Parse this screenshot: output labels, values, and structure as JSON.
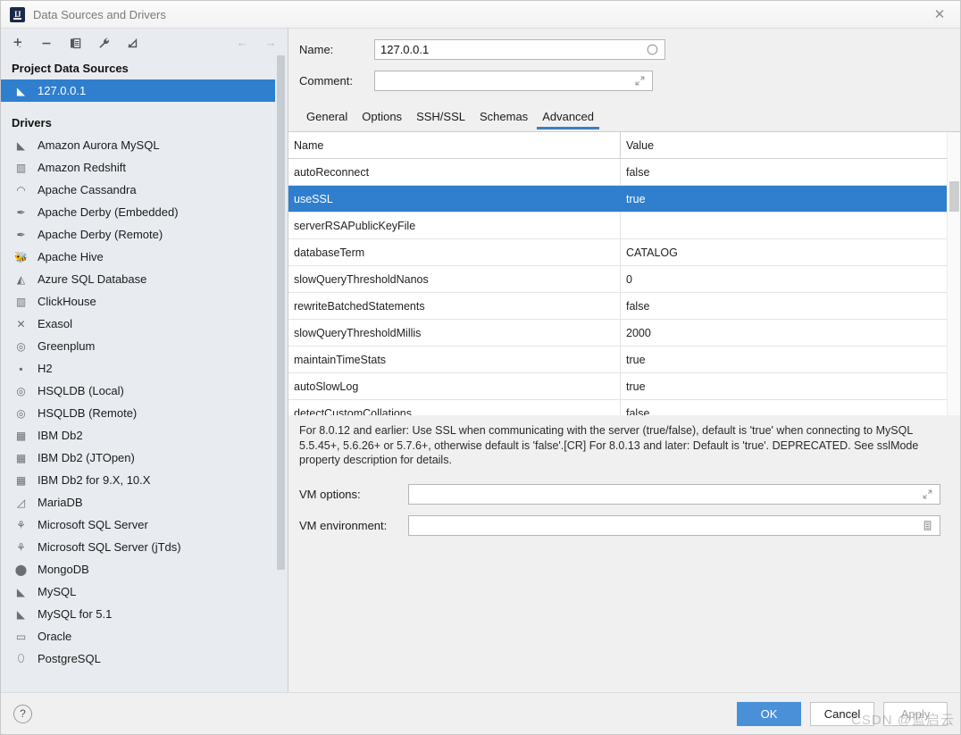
{
  "window": {
    "title": "Data Sources and Drivers",
    "app_icon": "intellij-icon",
    "close_icon": "✕"
  },
  "toolbar": {
    "items": [
      {
        "name": "add-button",
        "glyph": "+"
      },
      {
        "name": "remove-button",
        "glyph": "−"
      },
      {
        "name": "copy-button",
        "glyph": "❐"
      },
      {
        "name": "settings-wrench-button",
        "glyph": "🔧"
      },
      {
        "name": "import-button",
        "glyph": "⤦"
      }
    ],
    "back_glyph": "←",
    "forward_glyph": "→"
  },
  "sidebar": {
    "project_group_title": "Project Data Sources",
    "data_sources": [
      {
        "label": "127.0.0.1",
        "icon": "mysql-icon",
        "glyph": "◣",
        "selected": true
      }
    ],
    "drivers_group_title": "Drivers",
    "drivers": [
      {
        "label": "Amazon Aurora MySQL",
        "icon": "mysql-icon",
        "glyph": "◣"
      },
      {
        "label": "Amazon Redshift",
        "icon": "redshift-icon",
        "glyph": "▥"
      },
      {
        "label": "Apache Cassandra",
        "icon": "cassandra-icon",
        "glyph": "◠"
      },
      {
        "label": "Apache Derby (Embedded)",
        "icon": "derby-icon",
        "glyph": "✒"
      },
      {
        "label": "Apache Derby (Remote)",
        "icon": "derby-icon",
        "glyph": "✒"
      },
      {
        "label": "Apache Hive",
        "icon": "hive-icon",
        "glyph": "🐝"
      },
      {
        "label": "Azure SQL Database",
        "icon": "azure-icon",
        "glyph": "◭"
      },
      {
        "label": "ClickHouse",
        "icon": "clickhouse-icon",
        "glyph": "▥"
      },
      {
        "label": "Exasol",
        "icon": "exasol-icon",
        "glyph": "✕"
      },
      {
        "label": "Greenplum",
        "icon": "greenplum-icon",
        "glyph": "◎"
      },
      {
        "label": "H2",
        "icon": "h2-icon",
        "glyph": "▪"
      },
      {
        "label": "HSQLDB (Local)",
        "icon": "hsqldb-icon",
        "glyph": "◎"
      },
      {
        "label": "HSQLDB (Remote)",
        "icon": "hsqldb-icon",
        "glyph": "◎"
      },
      {
        "label": "IBM Db2",
        "icon": "db2-icon",
        "glyph": "▦"
      },
      {
        "label": "IBM Db2 (JTOpen)",
        "icon": "db2-icon",
        "glyph": "▦"
      },
      {
        "label": "IBM Db2 for 9.X, 10.X",
        "icon": "db2-icon",
        "glyph": "▦"
      },
      {
        "label": "MariaDB",
        "icon": "mariadb-icon",
        "glyph": "◿"
      },
      {
        "label": "Microsoft SQL Server",
        "icon": "mssql-icon",
        "glyph": "⚘"
      },
      {
        "label": "Microsoft SQL Server (jTds)",
        "icon": "mssql-icon",
        "glyph": "⚘"
      },
      {
        "label": "MongoDB",
        "icon": "mongodb-icon",
        "glyph": "⬤"
      },
      {
        "label": "MySQL",
        "icon": "mysql-icon",
        "glyph": "◣"
      },
      {
        "label": "MySQL for 5.1",
        "icon": "mysql-icon",
        "glyph": "◣"
      },
      {
        "label": "Oracle",
        "icon": "oracle-icon",
        "glyph": "▭"
      },
      {
        "label": "PostgreSQL",
        "icon": "postgresql-icon",
        "glyph": "⬯"
      }
    ]
  },
  "form": {
    "name_label": "Name:",
    "name_value": "127.0.0.1",
    "name_adorn_icon": "circle-status-icon",
    "comment_label": "Comment:",
    "comment_value": "",
    "comment_placeholder": "",
    "comment_adorn_icon": "expand-icon"
  },
  "tabs": [
    {
      "label": "General",
      "active": false
    },
    {
      "label": "Options",
      "active": false
    },
    {
      "label": "SSH/SSL",
      "active": false
    },
    {
      "label": "Schemas",
      "active": false
    },
    {
      "label": "Advanced",
      "active": true
    }
  ],
  "table": {
    "columns": [
      "Name",
      "Value"
    ],
    "rows": [
      {
        "name": "autoReconnect",
        "value": "false",
        "selected": false
      },
      {
        "name": "useSSL",
        "value": "true",
        "selected": true
      },
      {
        "name": "serverRSAPublicKeyFile",
        "value": "",
        "selected": false
      },
      {
        "name": "databaseTerm",
        "value": "CATALOG",
        "selected": false
      },
      {
        "name": "slowQueryThresholdNanos",
        "value": "0",
        "selected": false
      },
      {
        "name": "rewriteBatchedStatements",
        "value": "false",
        "selected": false
      },
      {
        "name": "slowQueryThresholdMillis",
        "value": "2000",
        "selected": false
      },
      {
        "name": "maintainTimeStats",
        "value": "true",
        "selected": false
      },
      {
        "name": "autoSlowLog",
        "value": "true",
        "selected": false
      },
      {
        "name": "detectCustomCollations",
        "value": "false",
        "selected": false
      }
    ]
  },
  "description": "For 8.0.12 and earlier: Use SSL when communicating with the server (true/false), default is 'true' when connecting to MySQL 5.5.45+, 5.6.26+ or 5.7.6+, otherwise default is 'false'.[CR] For 8.0.13 and later: Default is 'true'. DEPRECATED. See sslMode property description for details.",
  "vm": {
    "options_label": "VM options:",
    "options_value": "",
    "options_adorn_icon": "expand-icon",
    "environment_label": "VM environment:",
    "environment_value": "",
    "environment_adorn_icon": "list-edit-icon"
  },
  "footer": {
    "help_label": "?",
    "ok_label": "OK",
    "cancel_label": "Cancel",
    "apply_label": "Apply"
  },
  "watermark": "CSDN @蓝启云",
  "colors": {
    "selection_blue": "#2f7fce",
    "primary_button": "#4a90d9",
    "tab_underline": "#3d7fc0",
    "panel_background": "#e8ecf0"
  }
}
